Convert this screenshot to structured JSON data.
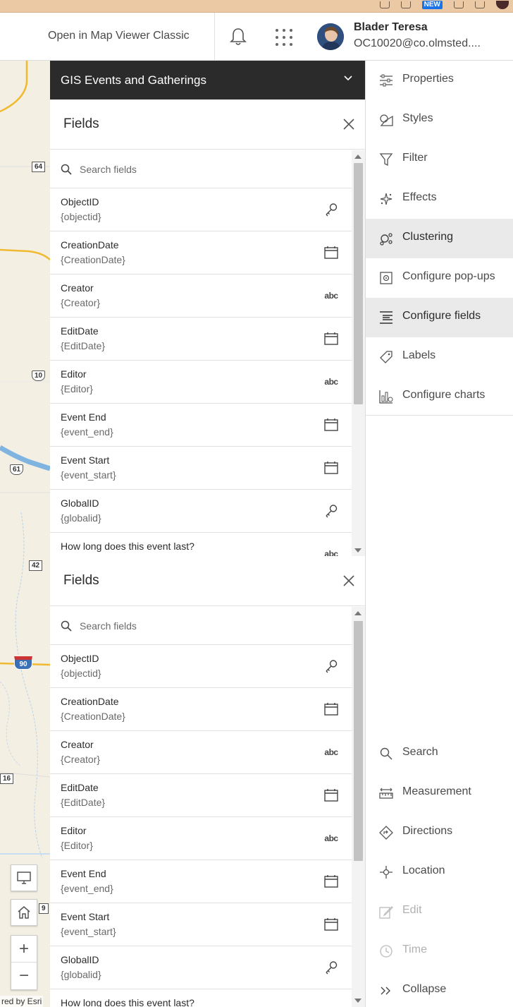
{
  "browser": {
    "new_badge": "NEW"
  },
  "header": {
    "open_classic": "Open in Map Viewer Classic",
    "user_name": "Blader Teresa",
    "user_email": "OC10020@co.olmsted...."
  },
  "map": {
    "shields": [
      "64",
      "10",
      "61",
      "42",
      "90",
      "16",
      "9"
    ],
    "attribution": "red by Esri"
  },
  "layer": {
    "title": "GIS Events and Gatherings"
  },
  "fields_panel": {
    "title": "Fields",
    "search_placeholder": "Search fields",
    "items": [
      {
        "name": "ObjectID",
        "key": "{objectid}",
        "type_icon": "key-icon"
      },
      {
        "name": "CreationDate",
        "key": "{CreationDate}",
        "type_icon": "calendar-icon"
      },
      {
        "name": "Creator",
        "key": "{Creator}",
        "type_icon": "string-icon"
      },
      {
        "name": "EditDate",
        "key": "{EditDate}",
        "type_icon": "calendar-icon"
      },
      {
        "name": "Editor",
        "key": "{Editor}",
        "type_icon": "string-icon"
      },
      {
        "name": "Event End",
        "key": "{event_end}",
        "type_icon": "calendar-icon"
      },
      {
        "name": "Event Start",
        "key": "{event_start}",
        "type_icon": "calendar-icon"
      },
      {
        "name": "GlobalID",
        "key": "{globalid}",
        "type_icon": "key-icon"
      },
      {
        "name": "How long does this event last?",
        "key": "",
        "type_icon": "string-icon"
      }
    ],
    "type_abc_label": "abc"
  },
  "right_panel": {
    "top_items": [
      {
        "label": "Properties",
        "icon": "properties-icon",
        "active": false
      },
      {
        "label": "Styles",
        "icon": "styles-icon",
        "active": false
      },
      {
        "label": "Filter",
        "icon": "filter-icon",
        "active": false
      },
      {
        "label": "Effects",
        "icon": "effects-icon",
        "active": false
      },
      {
        "label": "Clustering",
        "icon": "clustering-icon",
        "active": true
      },
      {
        "label": "Configure pop-ups",
        "icon": "popup-icon",
        "active": false
      },
      {
        "label": "Configure fields",
        "icon": "configure-fields-icon",
        "active": true
      },
      {
        "label": "Labels",
        "icon": "labels-icon",
        "active": false
      },
      {
        "label": "Configure charts",
        "icon": "charts-icon",
        "active": false
      }
    ],
    "bottom_items": [
      {
        "label": "Search",
        "icon": "search-icon",
        "disabled": false
      },
      {
        "label": "Measurement",
        "icon": "measurement-icon",
        "disabled": false
      },
      {
        "label": "Directions",
        "icon": "directions-icon",
        "disabled": false
      },
      {
        "label": "Location",
        "icon": "location-icon",
        "disabled": false
      },
      {
        "label": "Edit",
        "icon": "edit-icon",
        "disabled": true
      },
      {
        "label": "Time",
        "icon": "time-icon",
        "disabled": true
      },
      {
        "label": "Collapse",
        "icon": "collapse-icon",
        "disabled": false
      }
    ]
  }
}
